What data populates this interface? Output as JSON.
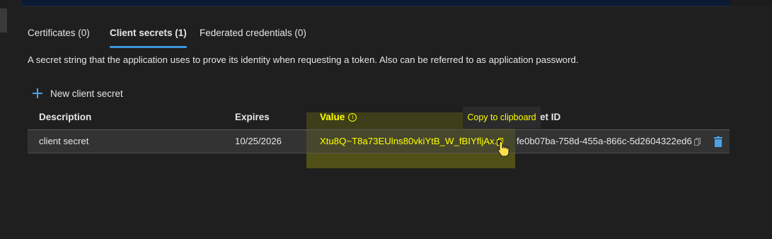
{
  "tabs": [
    {
      "label": "Certificates (0)"
    },
    {
      "label": "Client secrets (1)"
    },
    {
      "label": "Federated credentials (0)"
    }
  ],
  "active_tab": "Client secrets (1)",
  "description": "A secret string that the application uses to prove its identity when requesting a token. Also can be referred to as application password.",
  "toolbar": {
    "new_secret_label": "New client secret"
  },
  "table": {
    "columns": {
      "description": "Description",
      "expires": "Expires",
      "value": "Value",
      "secret_id": "et ID"
    },
    "rows": [
      {
        "description": "client secret",
        "expires": "10/25/2026",
        "value": "Xtu8Q~T8a73EUlns80vkiYtB_W_fBIYfljAx...",
        "secret_id": "fe0b07ba-758d-455a-866c-5d2604322ed6"
      }
    ]
  },
  "tooltip": {
    "text": "Copy to clipboard"
  },
  "colors": {
    "accent": "#3a96dd",
    "highlight_text": "#ffff00",
    "background": "#1f1f1f",
    "row": "#333333"
  }
}
